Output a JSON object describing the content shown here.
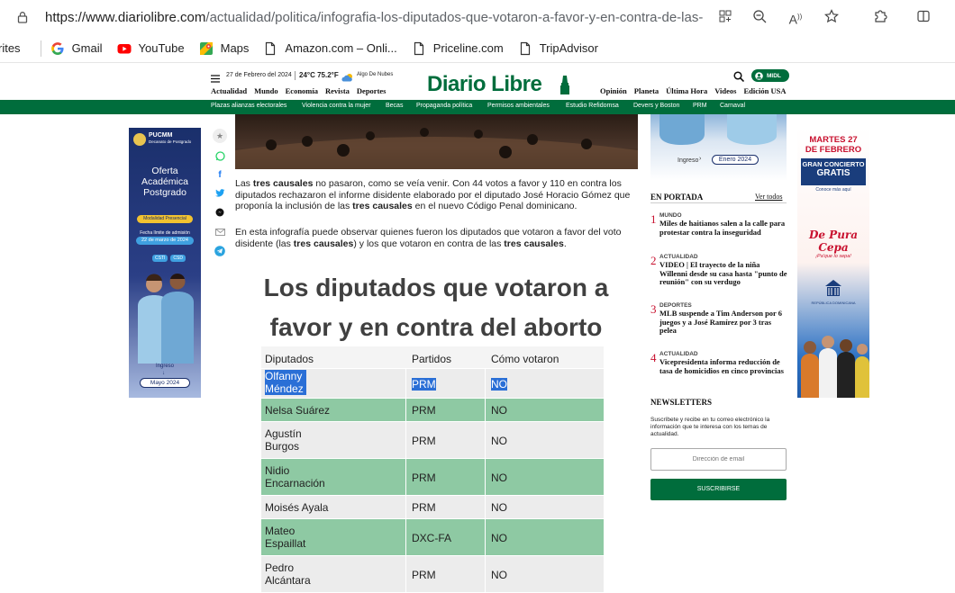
{
  "browser": {
    "url_domain": "https://www.diariolibre.com",
    "url_path": "/actualidad/politica/infografia-los-diputados-que-votaron-a-favor-y-en-contra-de-las-tre...",
    "bookmarks": [
      {
        "label": "rites",
        "icon": "none"
      },
      {
        "label": "Gmail",
        "icon": "google-icon"
      },
      {
        "label": "YouTube",
        "icon": "youtube-icon"
      },
      {
        "label": "Maps",
        "icon": "maps-icon"
      },
      {
        "label": "Amazon.com – Onli...",
        "icon": "page-icon"
      },
      {
        "label": "Priceline.com",
        "icon": "page-icon"
      },
      {
        "label": "TripAdvisor",
        "icon": "page-icon"
      }
    ]
  },
  "header": {
    "date": "27 de Febrero del 2024",
    "weather": "24°C 75.2°F",
    "weather_desc": "Algo De Nubes",
    "logo": "Diario Libre",
    "left_nav": [
      "Actualidad",
      "Mundo",
      "Economía",
      "Revista",
      "Deportes"
    ],
    "right_nav": [
      "Opinión",
      "Planeta",
      "Última Hora",
      "Videos",
      "Edición USA"
    ],
    "user_label": "MIDL",
    "tags": [
      "Plazas alianzas electorales",
      "Violencia contra la mujer",
      "Becas",
      "Propaganda política",
      "Permisos ambientales",
      "Estudio Refidomsa",
      "Devers y Boston",
      "PRM",
      "Carnaval"
    ]
  },
  "ad_left": {
    "brand": "PUCMM",
    "brand_sub": "Decanato de Postgrado",
    "title1": "Oferta",
    "title2": "Académica",
    "title3": "Postgrado",
    "badge": "Modalidad Presencial",
    "deadline_label": "Fecha límite de admisión",
    "deadline": "22 de marzo de 2024",
    "campus1": "CSTI",
    "campus2": "CSD",
    "ingreso": "Ingreso",
    "ingreso_date": "Mayo 2024"
  },
  "article": {
    "p1_a": "Las ",
    "p1_b": "tres causales",
    "p1_c": " no pasaron, como se veía venir. Con 44 votos a favor y 110 en contra los diputados rechazaron el informe disidente elaborado por el diputado José Horacio Gómez que proponía la inclusión de las ",
    "p1_d": "tres causales",
    "p1_e": " en el nuevo Código Penal dominicano.",
    "p2_a": "En esta infografía puede observar quienes fueron los diputados que votaron a favor del voto disidente (las ",
    "p2_b": "tres causales",
    "p2_c": ") y los que votaron en contra de las ",
    "p2_d": "tres causales",
    "p2_e": ".",
    "info_title_1": "Los diputados que votaron a",
    "info_title_2": "favor y en contra del aborto"
  },
  "table": {
    "headers": [
      "Diputados",
      "Partidos",
      "Cómo votaron"
    ],
    "rows": [
      [
        "Olfanny Méndez",
        "PRM",
        "NO"
      ],
      [
        "Nelsa Suárez",
        "PRM",
        "NO"
      ],
      [
        "Agustín Burgos",
        "PRM",
        "NO"
      ],
      [
        "Nidio Encarnación",
        "PRM",
        "NO"
      ],
      [
        "Moisés Ayala",
        "PRM",
        "NO"
      ],
      [
        "Mateo Espaillat",
        "DXC-FA",
        "NO"
      ],
      [
        "Pedro Alcántara",
        "PRM",
        "NO"
      ]
    ]
  },
  "right_ad": {
    "ingreso": "Ingreso",
    "date": "Enero 2024"
  },
  "portada": {
    "title": "EN PORTADA",
    "see_all": "Ver todos",
    "items": [
      {
        "num": "1",
        "cat": "MUNDO",
        "headline": "Miles de haitianos salen a la calle para protestar contra la inseguridad"
      },
      {
        "num": "2",
        "cat": "ACTUALIDAD",
        "headline": "VIDEO | El trayecto de la niña Willenni desde su casa hasta \"punto de reunión\" con su verdugo"
      },
      {
        "num": "3",
        "cat": "DEPORTES",
        "headline": "MLB suspende a Tim Anderson por 6 juegos y a José Ramírez por 3 tras pelea"
      },
      {
        "num": "4",
        "cat": "ACTUALIDAD",
        "headline": "Vicepresidenta informa reducción de tasa de homicidios en cinco provincias"
      }
    ]
  },
  "newsletter": {
    "title": "NEWSLETTERS",
    "desc": "Suscríbete y recibe en tu correo electrónico la información que te interesa con los temas de actualidad.",
    "placeholder": "Dirección de email",
    "button": "SUSCRIBIRSE"
  },
  "ad_right": {
    "date_line1": "MARTES 27",
    "date_line2": "DE FEBRERO",
    "concert1": "GRAN CONCIERTO",
    "concert2": "GRATIS",
    "sub": "Conoce más aquí",
    "brand": "De Pura Cepa",
    "tagline": "¡Pa'que lo sepa!",
    "footer": "REPÚBLICA DOMINICANA"
  },
  "colors": {
    "green": "#006d3c",
    "row_green": "#8ec9a3",
    "row_white": "#ececec",
    "red_num": "#c8102e"
  }
}
